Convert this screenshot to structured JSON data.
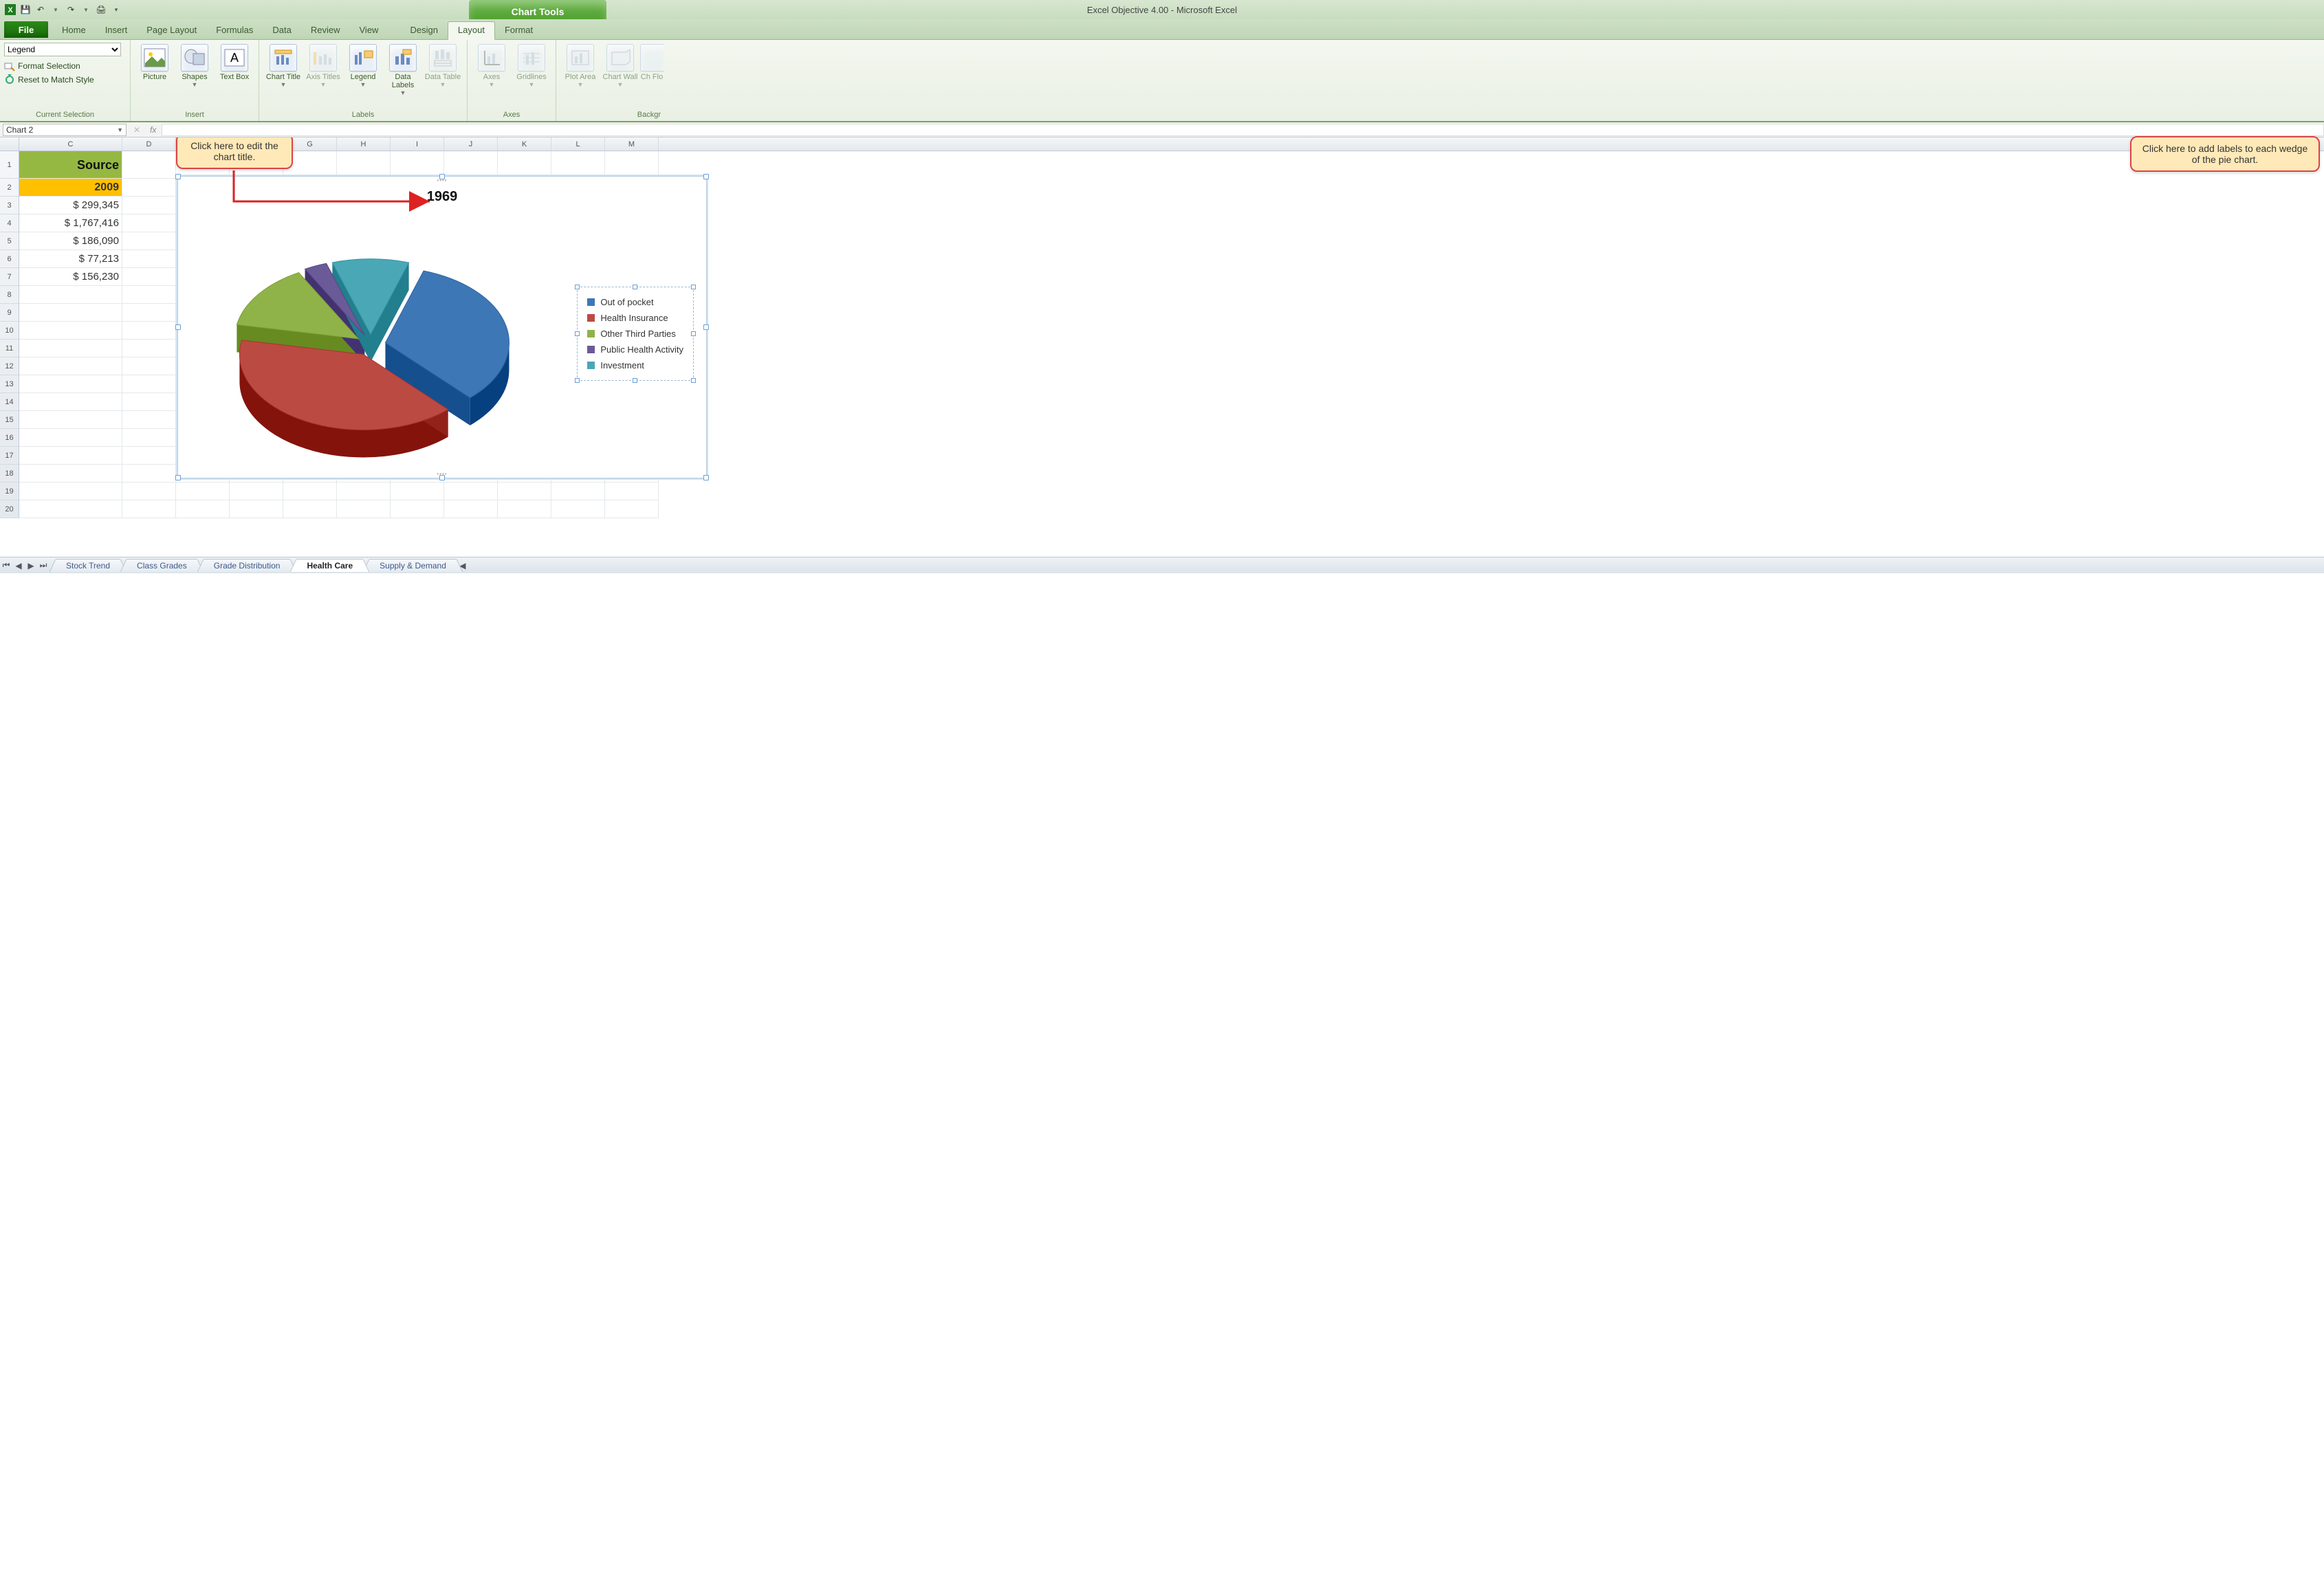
{
  "app": {
    "title": "Excel Objective 4.00 - Microsoft Excel",
    "contextual_tab": "Chart Tools"
  },
  "qat": {
    "save": "💾",
    "undo": "↶",
    "redo": "↷",
    "print": "🖨",
    "customize": "▾"
  },
  "tabs": [
    "File",
    "Home",
    "Insert",
    "Page Layout",
    "Formulas",
    "Data",
    "Review",
    "View",
    "Design",
    "Layout",
    "Format"
  ],
  "active_tab": "Layout",
  "ribbon": {
    "selection_value": "Legend",
    "format_selection": "Format Selection",
    "reset_style": "Reset to Match Style",
    "group_current": "Current Selection",
    "group_insert": "Insert",
    "group_labels": "Labels",
    "group_axes": "Axes",
    "group_bg": "Backgr",
    "btn_picture": "Picture",
    "btn_shapes": "Shapes",
    "btn_textbox": "Text Box",
    "btn_charttitle": "Chart Title",
    "btn_axistitles": "Axis Titles",
    "btn_legend": "Legend",
    "btn_datalabels": "Data Labels",
    "btn_datatable": "Data Table",
    "btn_axes": "Axes",
    "btn_gridlines": "Gridlines",
    "btn_plotarea": "Plot Area",
    "btn_chartwall": "Chart Wall",
    "btn_chartfloor": "Ch Flo"
  },
  "namebox": "Chart 2",
  "columns": [
    "C",
    "D",
    "E",
    "F",
    "G",
    "H",
    "I",
    "J",
    "K",
    "L",
    "M"
  ],
  "col_widths": {
    "C": 150,
    "default": 78
  },
  "rows_shown": 20,
  "cells": {
    "header_label": "Source",
    "year": "2009",
    "values": [
      "$    299,345",
      "$ 1,767,416",
      "$    186,090",
      "$      77,213",
      "$    156,230"
    ]
  },
  "chart_data": {
    "type": "pie",
    "title": "1969",
    "series": [
      {
        "name": "Out of pocket",
        "value": 33,
        "color": "#3e77b6"
      },
      {
        "name": "Health Insurance",
        "value": 40,
        "color": "#bb4a43"
      },
      {
        "name": "Other Third Parties",
        "value": 14,
        "color": "#8fb348"
      },
      {
        "name": "Public Health Activity",
        "value": 3,
        "color": "#6b5a98"
      },
      {
        "name": "Investment",
        "value": 10,
        "color": "#4aa7b6"
      }
    ],
    "exploded": true,
    "style_3d": true,
    "legend_position": "right"
  },
  "sheets": [
    "Stock Trend",
    "Class Grades",
    "Grade Distribution",
    "Health Care",
    "Supply & Demand"
  ],
  "active_sheet": "Health Care",
  "callouts": {
    "title_edit": "Click here to edit the chart title.",
    "labels_add": "Click here to add labels to each wedge of the pie chart."
  }
}
